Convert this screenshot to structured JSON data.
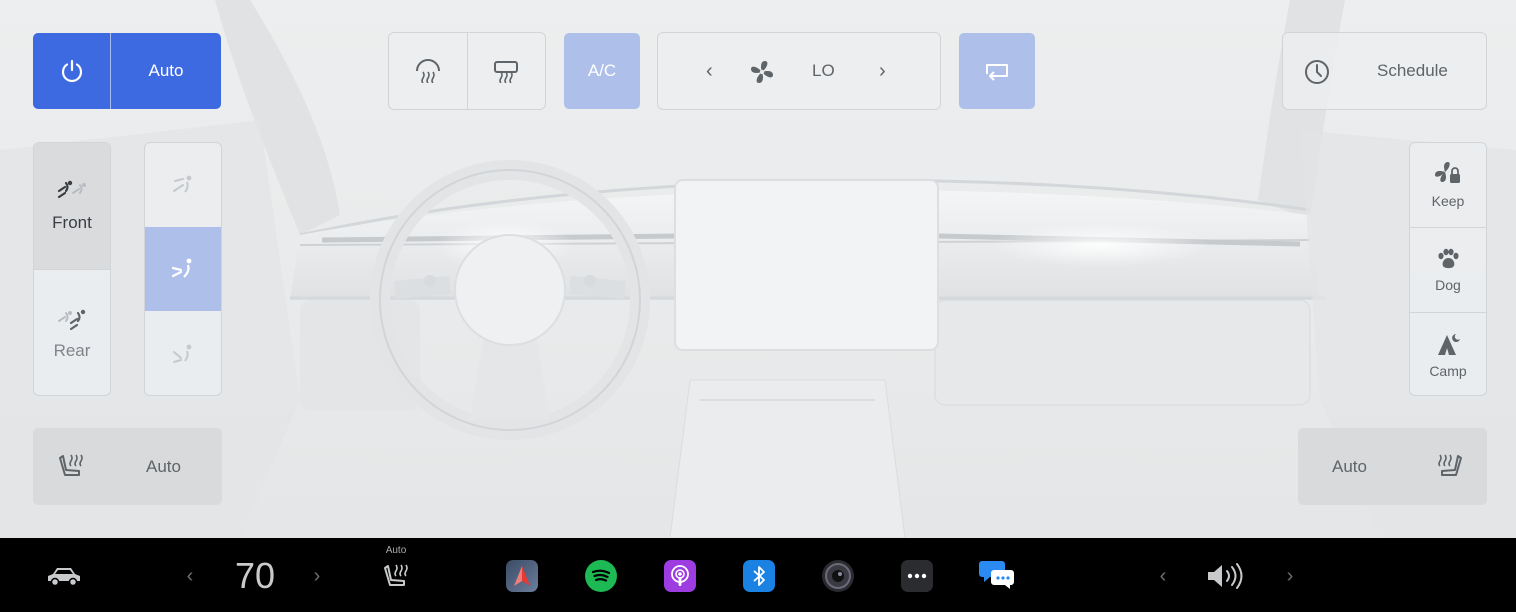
{
  "climate": {
    "power_auto": {
      "label": "Auto"
    },
    "ac_label": "A/C",
    "fan": {
      "speed": "LO"
    },
    "schedule_label": "Schedule",
    "zones": {
      "front": "Front",
      "rear": "Rear",
      "selected": "front"
    },
    "seat_heat_left": {
      "label": "Auto"
    },
    "seat_heat_right": {
      "label": "Auto"
    },
    "modes": [
      {
        "label": "Keep",
        "icon": "keep-fan-icon"
      },
      {
        "label": "Dog",
        "icon": "paw-icon"
      },
      {
        "label": "Camp",
        "icon": "camp-tent-icon"
      }
    ],
    "colors": {
      "accent": "#3e6ae1",
      "accent_light": "#aec0ea",
      "panel_border": "#d2d5d8",
      "text": "#5f6468"
    }
  },
  "taskbar": {
    "temperature": "70",
    "seat_heat_label": "Auto",
    "apps": [
      "navigation-icon",
      "spotify-icon",
      "podcasts-icon",
      "bluetooth-icon",
      "camera-icon",
      "more-icon",
      "messages-icon"
    ],
    "colors": {
      "spotify": "#1db954",
      "podcasts": "#9d3ce0",
      "bluetooth": "#1a82e2",
      "messages": "#2a8af2"
    }
  }
}
